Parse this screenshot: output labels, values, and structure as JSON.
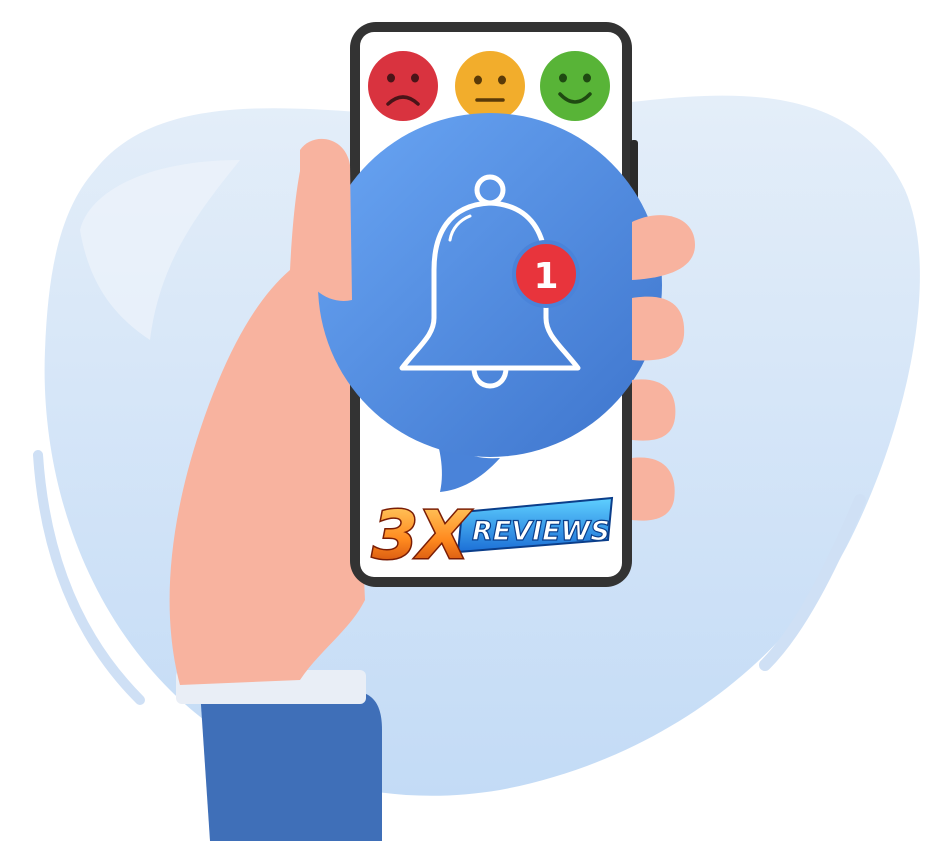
{
  "notification": {
    "count": "1",
    "icon": "bell-icon"
  },
  "ratings": [
    {
      "name": "sad-face-icon",
      "color": "#d9333f"
    },
    {
      "name": "neutral-face-icon",
      "color": "#f2ad2c"
    },
    {
      "name": "happy-face-icon",
      "color": "#58b437"
    }
  ],
  "logo": {
    "main": "3X",
    "sub": "REVIEWS"
  },
  "colors": {
    "blob": "#dbe8f8",
    "bubble": "#4c88e0",
    "badge": "#e8343c",
    "skin": "#f8b39f",
    "sleeve": "#3f6fb8",
    "phone_frame": "#333333"
  }
}
